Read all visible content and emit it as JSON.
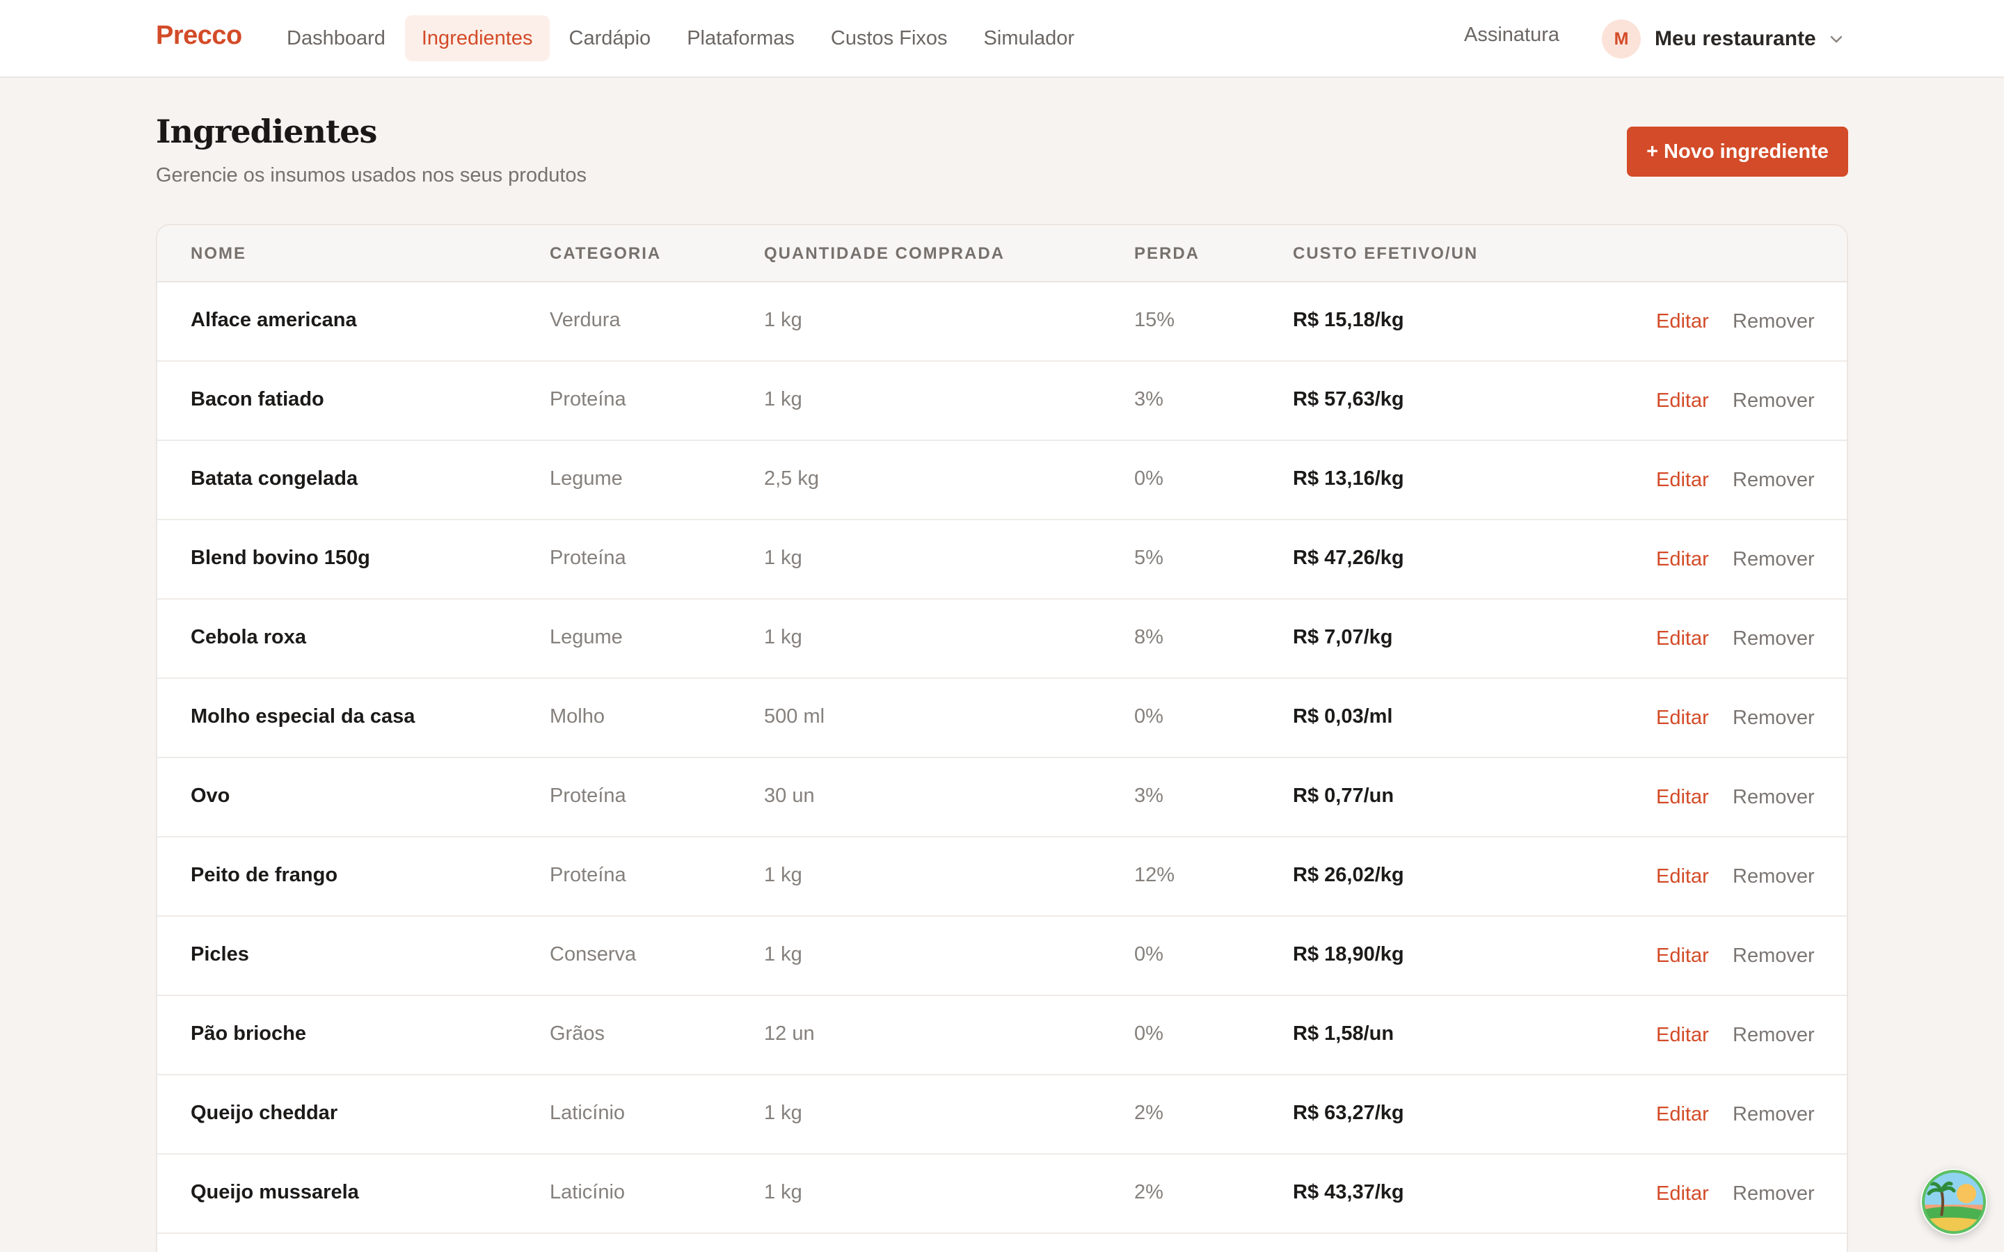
{
  "brand": "Precco",
  "nav": {
    "items": [
      {
        "label": "Dashboard",
        "active": false
      },
      {
        "label": "Ingredientes",
        "active": true
      },
      {
        "label": "Cardápio",
        "active": false
      },
      {
        "label": "Plataformas",
        "active": false
      },
      {
        "label": "Custos Fixos",
        "active": false
      },
      {
        "label": "Simulador",
        "active": false
      }
    ],
    "subscription": "Assinatura",
    "account": {
      "initial": "M",
      "name": "Meu restaurante"
    }
  },
  "header": {
    "title": "Ingredientes",
    "subtitle": "Gerencie os insumos usados nos seus produtos",
    "new_button": "+ Novo ingrediente"
  },
  "table": {
    "columns": [
      "NOME",
      "CATEGORIA",
      "QUANTIDADE COMPRADA",
      "PERDA",
      "CUSTO EFETIVO/UN"
    ],
    "edit_label": "Editar",
    "remove_label": "Remover",
    "rows": [
      {
        "name": "Alface americana",
        "category": "Verdura",
        "quantity": "1 kg",
        "loss": "15%",
        "cost": "R$ 15,18/kg"
      },
      {
        "name": "Bacon fatiado",
        "category": "Proteína",
        "quantity": "1 kg",
        "loss": "3%",
        "cost": "R$ 57,63/kg"
      },
      {
        "name": "Batata congelada",
        "category": "Legume",
        "quantity": "2,5 kg",
        "loss": "0%",
        "cost": "R$ 13,16/kg"
      },
      {
        "name": "Blend bovino 150g",
        "category": "Proteína",
        "quantity": "1 kg",
        "loss": "5%",
        "cost": "R$ 47,26/kg"
      },
      {
        "name": "Cebola roxa",
        "category": "Legume",
        "quantity": "1 kg",
        "loss": "8%",
        "cost": "R$ 7,07/kg"
      },
      {
        "name": "Molho especial da casa",
        "category": "Molho",
        "quantity": "500 ml",
        "loss": "0%",
        "cost": "R$ 0,03/ml"
      },
      {
        "name": "Ovo",
        "category": "Proteína",
        "quantity": "30 un",
        "loss": "3%",
        "cost": "R$ 0,77/un"
      },
      {
        "name": "Peito de frango",
        "category": "Proteína",
        "quantity": "1 kg",
        "loss": "12%",
        "cost": "R$ 26,02/kg"
      },
      {
        "name": "Picles",
        "category": "Conserva",
        "quantity": "1 kg",
        "loss": "0%",
        "cost": "R$ 18,90/kg"
      },
      {
        "name": "Pão brioche",
        "category": "Grãos",
        "quantity": "12 un",
        "loss": "0%",
        "cost": "R$ 1,58/un"
      },
      {
        "name": "Queijo cheddar",
        "category": "Laticínio",
        "quantity": "1 kg",
        "loss": "2%",
        "cost": "R$ 63,27/kg"
      },
      {
        "name": "Queijo mussarela",
        "category": "Laticínio",
        "quantity": "1 kg",
        "loss": "2%",
        "cost": "R$ 43,37/kg"
      }
    ]
  },
  "colors": {
    "accent": "#d34b28",
    "background": "#f6f3f0"
  },
  "icons": {
    "account_chevron": "chevron-down-icon",
    "floating_badge": "beach-island-icon"
  }
}
